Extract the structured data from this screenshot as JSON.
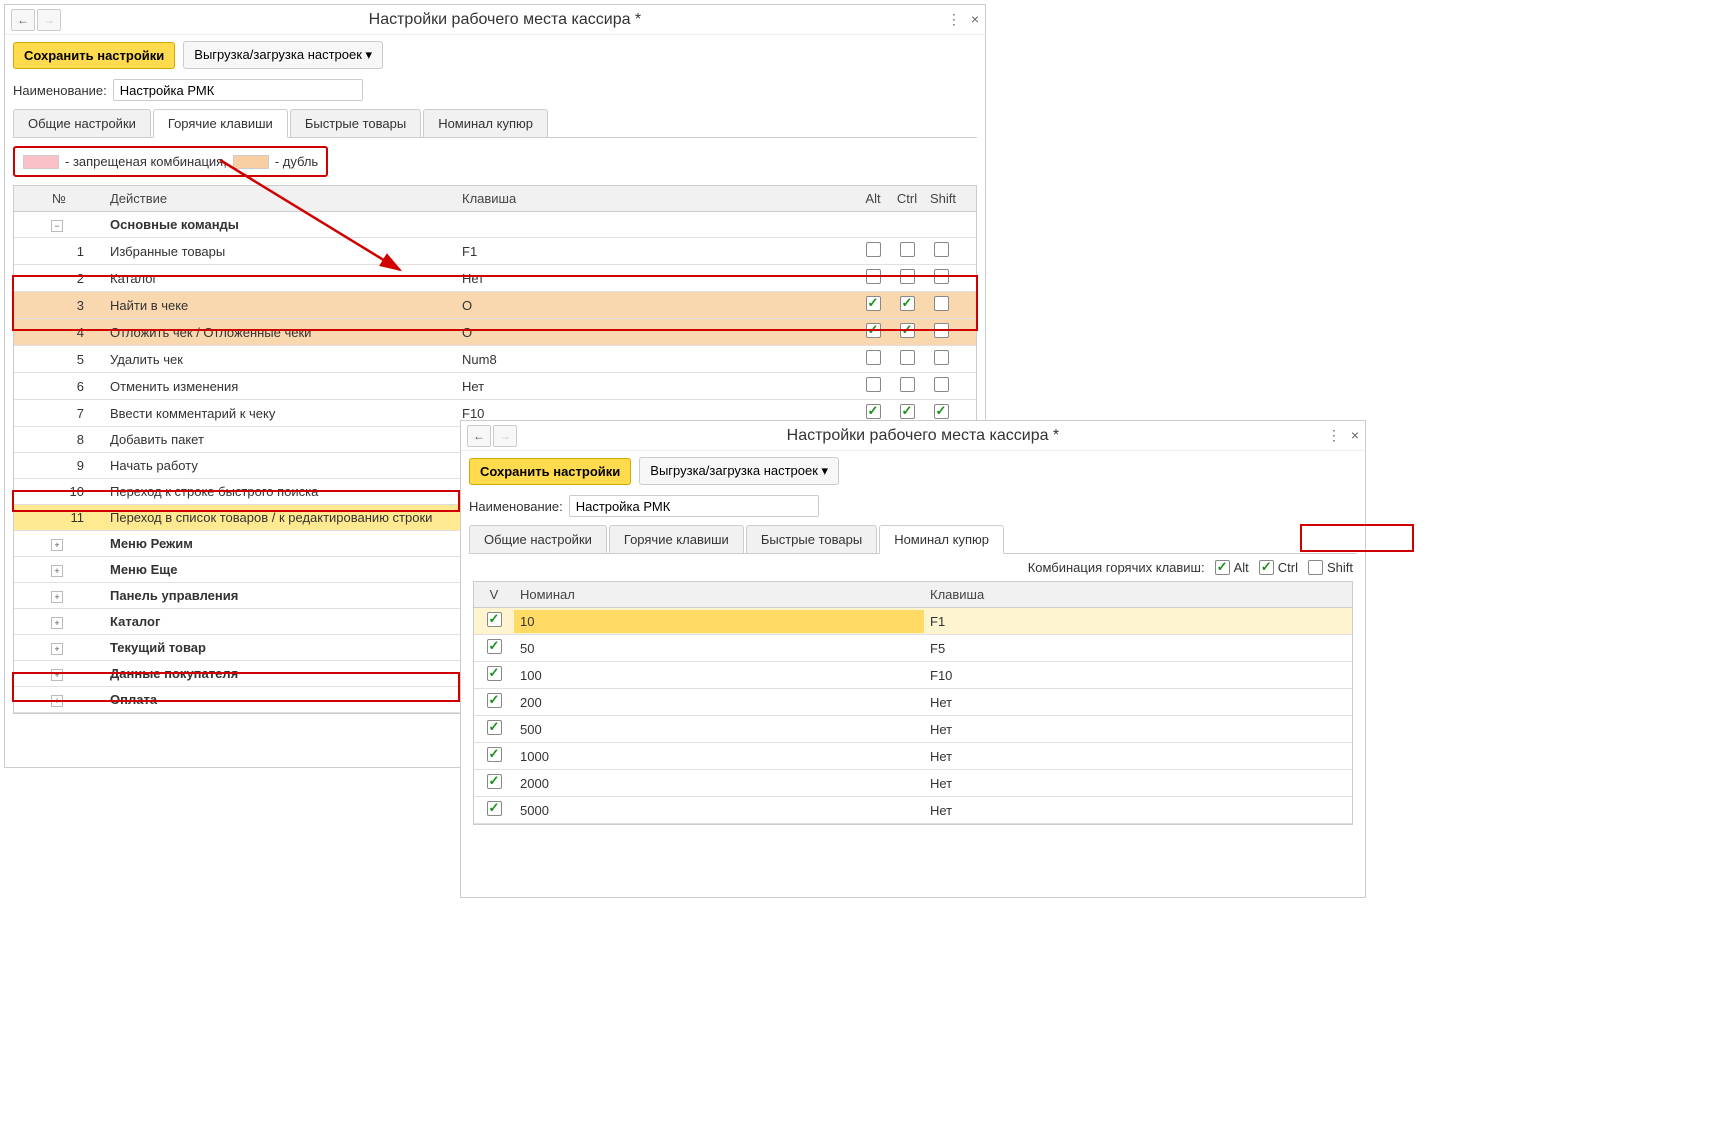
{
  "window1": {
    "title": "Настройки рабочего места кассира *",
    "toolbar": {
      "save": "Сохранить настройки",
      "export": "Выгрузка/загрузка настроек ▾"
    },
    "name_label": "Наименование:",
    "name_value": "Настройка РМК",
    "tabs": [
      "Общие настройки",
      "Горячие клавиши",
      "Быстрые товары",
      "Номинал купюр"
    ],
    "legend": {
      "forbidden": "- запрещеная комбинация,",
      "duplicate": "- дубль"
    },
    "columns": {
      "num": "№",
      "action": "Действие",
      "key": "Клавиша",
      "alt": "Alt",
      "ctrl": "Ctrl",
      "shift": "Shift"
    },
    "groups": [
      {
        "title": "Основные команды",
        "expanded": true,
        "rows": [
          {
            "n": "1",
            "action": "Избранные товары",
            "key": "F1",
            "alt": false,
            "ctrl": false,
            "shift": false
          },
          {
            "n": "2",
            "action": "Каталог",
            "key": "Нет",
            "alt": false,
            "ctrl": false,
            "shift": false
          },
          {
            "n": "3",
            "action": "Найти в чеке",
            "key": "O",
            "alt": true,
            "ctrl": true,
            "shift": false,
            "peach": true
          },
          {
            "n": "4",
            "action": "Отложить чек / Отложенные чеки",
            "key": "O",
            "alt": true,
            "ctrl": true,
            "shift": false,
            "peach": true
          },
          {
            "n": "5",
            "action": "Удалить чек",
            "key": "Num8",
            "alt": false,
            "ctrl": false,
            "shift": false
          },
          {
            "n": "6",
            "action": "Отменить изменения",
            "key": "Нет",
            "alt": false,
            "ctrl": false,
            "shift": false
          },
          {
            "n": "7",
            "action": "Ввести комментарий к чеку",
            "key": "F10",
            "alt": true,
            "ctrl": true,
            "shift": true
          },
          {
            "n": "8",
            "action": "Добавить пакет",
            "key": "",
            "alt": false,
            "ctrl": false,
            "shift": false,
            "hidecb": true
          },
          {
            "n": "9",
            "action": "Начать работу",
            "key": "",
            "alt": false,
            "ctrl": false,
            "shift": false,
            "hidecb": true
          },
          {
            "n": "10",
            "action": "Переход к строке быстрого поиска",
            "key": "",
            "alt": false,
            "ctrl": false,
            "shift": false,
            "hidecb": true
          },
          {
            "n": "11",
            "action": "Переход в список товаров / к редактированию строки",
            "key": "",
            "alt": false,
            "ctrl": false,
            "shift": false,
            "yellow": true,
            "hidecb": true
          }
        ]
      },
      {
        "title": "Меню Режим",
        "expanded": false
      },
      {
        "title": "Меню Еще",
        "expanded": false
      },
      {
        "title": "Панель управления",
        "expanded": false
      },
      {
        "title": "Каталог",
        "expanded": false
      },
      {
        "title": "Текущий товар",
        "expanded": false
      },
      {
        "title": "Данные покупателя",
        "expanded": false
      },
      {
        "title": "Оплата",
        "expanded": false
      }
    ]
  },
  "window2": {
    "title": "Настройки рабочего места кассира *",
    "toolbar": {
      "save": "Сохранить настройки",
      "export": "Выгрузка/загрузка настроек ▾"
    },
    "name_label": "Наименование:",
    "name_value": "Настройка РМК",
    "tabs": [
      "Общие настройки",
      "Горячие клавиши",
      "Быстрые товары",
      "Номинал купюр"
    ],
    "combo_label": "Комбинация горячих клавиш:",
    "combo": {
      "alt": "Alt",
      "ctrl": "Ctrl",
      "shift": "Shift"
    },
    "columns": {
      "v": "V",
      "nominal": "Номинал",
      "key": "Клавиша"
    },
    "rows": [
      {
        "v": true,
        "nominal": "10",
        "key": "F1",
        "selected": true
      },
      {
        "v": true,
        "nominal": "50",
        "key": "F5"
      },
      {
        "v": true,
        "nominal": "100",
        "key": "F10"
      },
      {
        "v": true,
        "nominal": "200",
        "key": "Нет"
      },
      {
        "v": true,
        "nominal": "500",
        "key": "Нет"
      },
      {
        "v": true,
        "nominal": "1000",
        "key": "Нет"
      },
      {
        "v": true,
        "nominal": "2000",
        "key": "Нет"
      },
      {
        "v": true,
        "nominal": "5000",
        "key": "Нет"
      }
    ]
  }
}
